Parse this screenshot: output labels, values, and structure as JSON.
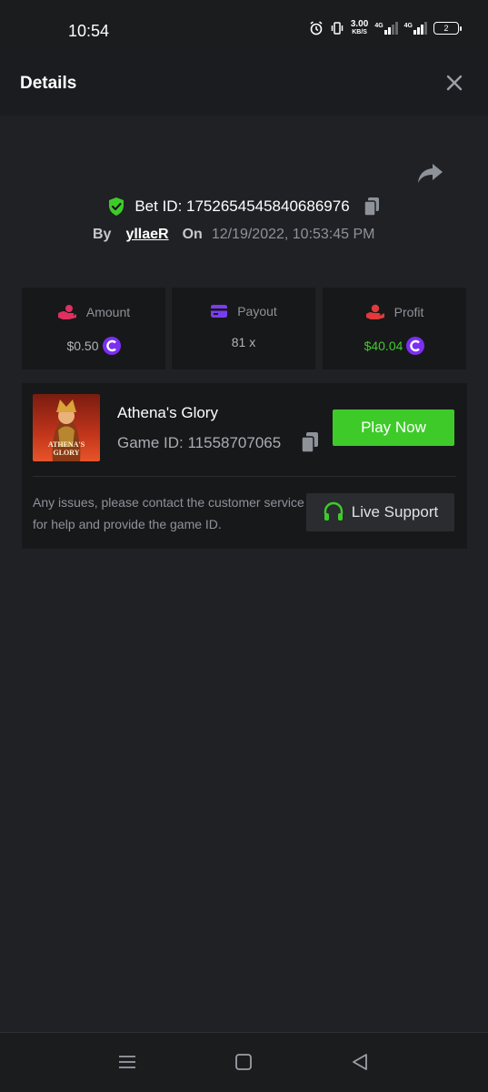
{
  "status_bar": {
    "time": "10:54",
    "speed_value": "3.00",
    "speed_unit": "KB/S",
    "network1": "4G",
    "network2": "4G",
    "battery": "2"
  },
  "header": {
    "title": "Details"
  },
  "bet": {
    "id_label": "Bet ID: 1752654545840686976",
    "by_label": "By",
    "username": "yllaeR",
    "on_label": "On",
    "datetime": "12/19/2022, 10:53:45 PM"
  },
  "stats": [
    {
      "label": "Amount",
      "value": "$0.50",
      "icon": "hand-coins-icon",
      "has_coin": true
    },
    {
      "label": "Payout",
      "value": "81 x",
      "icon": "card-icon",
      "has_coin": false
    },
    {
      "label": "Profit",
      "value": "$40.04",
      "icon": "hand-money-icon",
      "has_coin": true
    }
  ],
  "game": {
    "name": "Athena's Glory",
    "id_label": "Game ID: 11558707065",
    "thumb_text": "ATHENA'S GLORY",
    "play_label": "Play Now",
    "help_text": "Any issues, please contact the customer service for help and provide the game ID.",
    "support_label": "Live Support"
  },
  "colors": {
    "accent_green": "#3ecb2a",
    "coin_purple": "#7b2ff2",
    "amount_pink": "#e0305f",
    "payout_purple": "#7a3cf0",
    "profit_red": "#e23a3a"
  }
}
